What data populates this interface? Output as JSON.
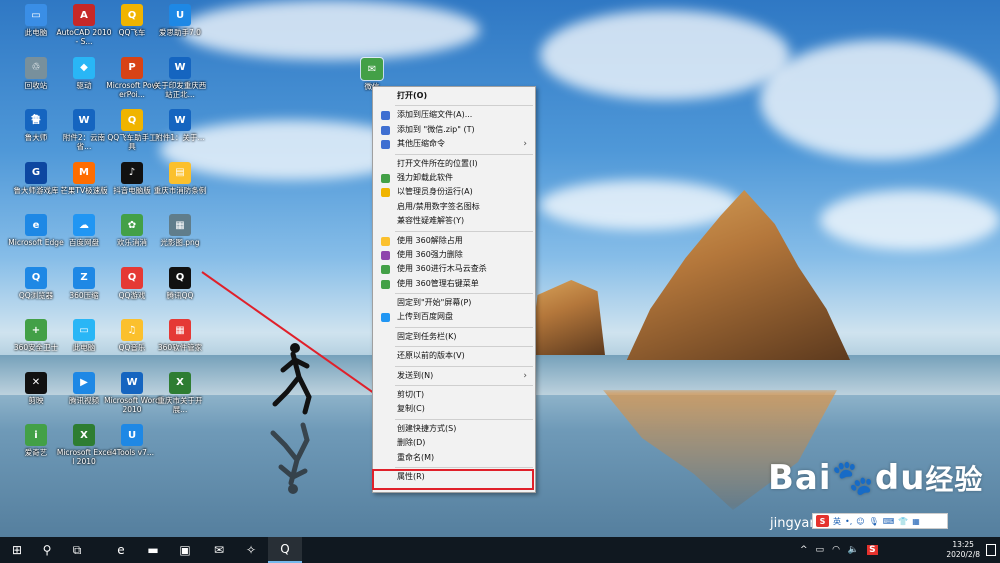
{
  "desktop": {
    "icons": [
      {
        "label": "此电脑",
        "color": "#3a8ee6",
        "glyph": "▭",
        "icon": "computer-icon"
      },
      {
        "label": "AutoCAD 2010 - S...",
        "color": "#c62828",
        "glyph": "A",
        "icon": "autocad-icon"
      },
      {
        "label": "QQ飞车",
        "color": "#f0b400",
        "glyph": "Q",
        "icon": "qq-speed-icon"
      },
      {
        "label": "爱思助手7.0",
        "color": "#1e88e5",
        "glyph": "U",
        "icon": "aisi-icon"
      },
      {
        "label": "回收站",
        "color": "#78909c",
        "glyph": "♲",
        "icon": "recycle-bin-icon"
      },
      {
        "label": "驱动",
        "color": "#29b6f6",
        "glyph": "◆",
        "icon": "driver-icon"
      },
      {
        "label": "Microsoft PowerPoi...",
        "color": "#d84315",
        "glyph": "P",
        "icon": "powerpoint-icon"
      },
      {
        "label": "关于印发重庆西站正北...",
        "color": "#1565c0",
        "glyph": "W",
        "icon": "word-doc-icon"
      },
      {
        "label": "鲁大师",
        "color": "#1565c0",
        "glyph": "鲁",
        "icon": "ludashi-icon"
      },
      {
        "label": "附件2：云南省...",
        "color": "#1565c0",
        "glyph": "W",
        "icon": "word-doc-icon"
      },
      {
        "label": "QQ飞车助手工具",
        "color": "#f0b400",
        "glyph": "Q",
        "icon": "qq-speed-helper-icon"
      },
      {
        "label": "附件1：关于...",
        "color": "#1565c0",
        "glyph": "W",
        "icon": "word-doc-icon"
      },
      {
        "label": "鲁大师游戏库",
        "color": "#0d47a1",
        "glyph": "G",
        "icon": "game-library-icon"
      },
      {
        "label": "芒果TV极速版",
        "color": "#ff6d00",
        "glyph": "M",
        "icon": "mango-tv-icon"
      },
      {
        "label": "抖音电脑版",
        "color": "#111111",
        "glyph": "♪",
        "icon": "douyin-icon"
      },
      {
        "label": "重庆市消防条例",
        "color": "#fbc02d",
        "glyph": "▤",
        "icon": "folder-icon"
      },
      {
        "label": "Microsoft Edge",
        "color": "#1e88e5",
        "glyph": "e",
        "icon": "edge-icon"
      },
      {
        "label": "百度网盘",
        "color": "#2196f3",
        "glyph": "☁",
        "icon": "baidu-netdisk-icon"
      },
      {
        "label": "欢乐消消",
        "color": "#43a047",
        "glyph": "✿",
        "icon": "game-icon"
      },
      {
        "label": "光影图.png",
        "color": "#607d8b",
        "glyph": "▦",
        "icon": "image-file-icon"
      },
      {
        "label": "QQ浏览器",
        "color": "#1e88e5",
        "glyph": "Q",
        "icon": "qq-browser-icon"
      },
      {
        "label": "360压缩",
        "color": "#1e88e5",
        "glyph": "Z",
        "icon": "360-zip-icon"
      },
      {
        "label": "QQ游戏",
        "color": "#e53935",
        "glyph": "Q",
        "icon": "qq-game-icon"
      },
      {
        "label": "腾讯QQ",
        "color": "#111111",
        "glyph": "Q",
        "icon": "tencent-qq-icon"
      },
      {
        "label": "360安全卫士",
        "color": "#43a047",
        "glyph": "+",
        "icon": "360-security-icon"
      },
      {
        "label": "此电脑",
        "color": "#29b6f6",
        "glyph": "▭",
        "icon": "computer-shortcut-icon"
      },
      {
        "label": "QQ音乐",
        "color": "#fbc02d",
        "glyph": "♫",
        "icon": "qq-music-icon"
      },
      {
        "label": "360软件管家",
        "color": "#e53935",
        "glyph": "▦",
        "icon": "360-software-icon"
      },
      {
        "label": "剪映",
        "color": "#111111",
        "glyph": "✕",
        "icon": "jianying-icon"
      },
      {
        "label": "腾讯视频",
        "color": "#1e88e5",
        "glyph": "▶",
        "icon": "tencent-video-icon"
      },
      {
        "label": "Microsoft Word 2010",
        "color": "#1565c0",
        "glyph": "W",
        "icon": "word-icon"
      },
      {
        "label": "重庆市关于开展...",
        "color": "#2e7d32",
        "glyph": "X",
        "icon": "excel-doc-icon"
      },
      {
        "label": "爱奇艺",
        "color": "#43a047",
        "glyph": "i",
        "icon": "iqiyi-icon"
      },
      {
        "label": "Microsoft Excel 2010",
        "color": "#2e7d32",
        "glyph": "X",
        "icon": "excel-icon"
      },
      {
        "label": "i4Tools v7...",
        "color": "#1e88e5",
        "glyph": "U",
        "icon": "i4tools-icon"
      }
    ],
    "wechat_icon": {
      "label": "微信",
      "color": "#43a047",
      "glyph": "✉"
    }
  },
  "context_menu": {
    "groups": [
      [
        {
          "label": "打开(O)",
          "bold": true
        }
      ],
      [
        {
          "label": "添加到压缩文件(A)...",
          "icon": "archive-icon",
          "icon_color": "#3f6fd1"
        },
        {
          "label": "添加到 \"微信.zip\" (T)",
          "icon": "archive-icon",
          "icon_color": "#3f6fd1"
        },
        {
          "label": "其他压缩命令",
          "icon": "archive-icon",
          "icon_color": "#3f6fd1",
          "submenu": true
        }
      ],
      [
        {
          "label": "打开文件所在的位置(I)"
        },
        {
          "label": "强力卸载此软件",
          "icon": "uninstall-icon",
          "icon_color": "#43a047"
        },
        {
          "label": "以管理员身份运行(A)",
          "icon": "shield-icon",
          "icon_color": "#f0b400"
        },
        {
          "label": "启用/禁用数字签名图标"
        },
        {
          "label": "兼容性疑难解答(Y)"
        }
      ],
      [
        {
          "label": "使用 360解除占用",
          "icon": "unlock-icon",
          "icon_color": "#fbc02d"
        },
        {
          "label": "使用 360强力删除",
          "icon": "delete-icon",
          "icon_color": "#8e44ad"
        },
        {
          "label": "使用 360进行木马云查杀",
          "icon": "virus-scan-icon",
          "icon_color": "#43a047"
        },
        {
          "label": "使用 360管理右键菜单",
          "icon": "menu-manage-icon",
          "icon_color": "#43a047"
        }
      ],
      [
        {
          "label": "固定到\"开始\"屏幕(P)"
        },
        {
          "label": "上传到百度网盘",
          "icon": "cloud-upload-icon",
          "icon_color": "#2196f3"
        }
      ],
      [
        {
          "label": "固定到任务栏(K)"
        }
      ],
      [
        {
          "label": "还原以前的版本(V)"
        }
      ],
      [
        {
          "label": "发送到(N)",
          "submenu": true
        }
      ],
      [
        {
          "label": "剪切(T)"
        },
        {
          "label": "复制(C)"
        }
      ],
      [
        {
          "label": "创建快捷方式(S)"
        },
        {
          "label": "删除(D)"
        },
        {
          "label": "重命名(M)"
        }
      ],
      [
        {
          "label": "属性(R)"
        }
      ]
    ],
    "highlight_color": "#e0202a"
  },
  "watermark": {
    "main": "Bai",
    "du": "du",
    "cn": "经验",
    "url": "jingyan.baidu.com"
  },
  "ime_bar": {
    "logo": "S",
    "lang": "英"
  },
  "taskbar": {
    "buttons": [
      {
        "name": "start-button",
        "glyph": "⊞"
      },
      {
        "name": "search-button",
        "glyph": "⚲"
      },
      {
        "name": "task-view-button",
        "glyph": "⧉"
      },
      {
        "name": "edge-button",
        "glyph": "e"
      },
      {
        "name": "file-explorer-button",
        "glyph": "▬"
      },
      {
        "name": "store-button",
        "glyph": "▣"
      },
      {
        "name": "mail-button",
        "glyph": "✉"
      },
      {
        "name": "app-button",
        "glyph": "✧"
      },
      {
        "name": "qq-browser-button",
        "glyph": "Q"
      }
    ],
    "clock": {
      "time": "13:25",
      "date": "2020/2/8"
    }
  }
}
